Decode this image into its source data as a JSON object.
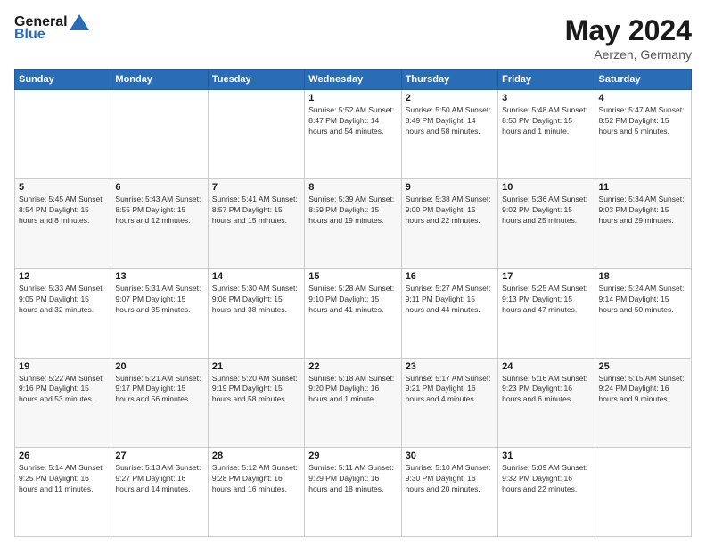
{
  "logo": {
    "text_general": "General",
    "text_blue": "Blue"
  },
  "title": {
    "month_year": "May 2024",
    "location": "Aerzen, Germany"
  },
  "weekdays": [
    "Sunday",
    "Monday",
    "Tuesday",
    "Wednesday",
    "Thursday",
    "Friday",
    "Saturday"
  ],
  "weeks": [
    [
      {
        "day": "",
        "info": ""
      },
      {
        "day": "",
        "info": ""
      },
      {
        "day": "",
        "info": ""
      },
      {
        "day": "1",
        "info": "Sunrise: 5:52 AM\nSunset: 8:47 PM\nDaylight: 14 hours\nand 54 minutes."
      },
      {
        "day": "2",
        "info": "Sunrise: 5:50 AM\nSunset: 8:49 PM\nDaylight: 14 hours\nand 58 minutes."
      },
      {
        "day": "3",
        "info": "Sunrise: 5:48 AM\nSunset: 8:50 PM\nDaylight: 15 hours\nand 1 minute."
      },
      {
        "day": "4",
        "info": "Sunrise: 5:47 AM\nSunset: 8:52 PM\nDaylight: 15 hours\nand 5 minutes."
      }
    ],
    [
      {
        "day": "5",
        "info": "Sunrise: 5:45 AM\nSunset: 8:54 PM\nDaylight: 15 hours\nand 8 minutes."
      },
      {
        "day": "6",
        "info": "Sunrise: 5:43 AM\nSunset: 8:55 PM\nDaylight: 15 hours\nand 12 minutes."
      },
      {
        "day": "7",
        "info": "Sunrise: 5:41 AM\nSunset: 8:57 PM\nDaylight: 15 hours\nand 15 minutes."
      },
      {
        "day": "8",
        "info": "Sunrise: 5:39 AM\nSunset: 8:59 PM\nDaylight: 15 hours\nand 19 minutes."
      },
      {
        "day": "9",
        "info": "Sunrise: 5:38 AM\nSunset: 9:00 PM\nDaylight: 15 hours\nand 22 minutes."
      },
      {
        "day": "10",
        "info": "Sunrise: 5:36 AM\nSunset: 9:02 PM\nDaylight: 15 hours\nand 25 minutes."
      },
      {
        "day": "11",
        "info": "Sunrise: 5:34 AM\nSunset: 9:03 PM\nDaylight: 15 hours\nand 29 minutes."
      }
    ],
    [
      {
        "day": "12",
        "info": "Sunrise: 5:33 AM\nSunset: 9:05 PM\nDaylight: 15 hours\nand 32 minutes."
      },
      {
        "day": "13",
        "info": "Sunrise: 5:31 AM\nSunset: 9:07 PM\nDaylight: 15 hours\nand 35 minutes."
      },
      {
        "day": "14",
        "info": "Sunrise: 5:30 AM\nSunset: 9:08 PM\nDaylight: 15 hours\nand 38 minutes."
      },
      {
        "day": "15",
        "info": "Sunrise: 5:28 AM\nSunset: 9:10 PM\nDaylight: 15 hours\nand 41 minutes."
      },
      {
        "day": "16",
        "info": "Sunrise: 5:27 AM\nSunset: 9:11 PM\nDaylight: 15 hours\nand 44 minutes."
      },
      {
        "day": "17",
        "info": "Sunrise: 5:25 AM\nSunset: 9:13 PM\nDaylight: 15 hours\nand 47 minutes."
      },
      {
        "day": "18",
        "info": "Sunrise: 5:24 AM\nSunset: 9:14 PM\nDaylight: 15 hours\nand 50 minutes."
      }
    ],
    [
      {
        "day": "19",
        "info": "Sunrise: 5:22 AM\nSunset: 9:16 PM\nDaylight: 15 hours\nand 53 minutes."
      },
      {
        "day": "20",
        "info": "Sunrise: 5:21 AM\nSunset: 9:17 PM\nDaylight: 15 hours\nand 56 minutes."
      },
      {
        "day": "21",
        "info": "Sunrise: 5:20 AM\nSunset: 9:19 PM\nDaylight: 15 hours\nand 58 minutes."
      },
      {
        "day": "22",
        "info": "Sunrise: 5:18 AM\nSunset: 9:20 PM\nDaylight: 16 hours\nand 1 minute."
      },
      {
        "day": "23",
        "info": "Sunrise: 5:17 AM\nSunset: 9:21 PM\nDaylight: 16 hours\nand 4 minutes."
      },
      {
        "day": "24",
        "info": "Sunrise: 5:16 AM\nSunset: 9:23 PM\nDaylight: 16 hours\nand 6 minutes."
      },
      {
        "day": "25",
        "info": "Sunrise: 5:15 AM\nSunset: 9:24 PM\nDaylight: 16 hours\nand 9 minutes."
      }
    ],
    [
      {
        "day": "26",
        "info": "Sunrise: 5:14 AM\nSunset: 9:25 PM\nDaylight: 16 hours\nand 11 minutes."
      },
      {
        "day": "27",
        "info": "Sunrise: 5:13 AM\nSunset: 9:27 PM\nDaylight: 16 hours\nand 14 minutes."
      },
      {
        "day": "28",
        "info": "Sunrise: 5:12 AM\nSunset: 9:28 PM\nDaylight: 16 hours\nand 16 minutes."
      },
      {
        "day": "29",
        "info": "Sunrise: 5:11 AM\nSunset: 9:29 PM\nDaylight: 16 hours\nand 18 minutes."
      },
      {
        "day": "30",
        "info": "Sunrise: 5:10 AM\nSunset: 9:30 PM\nDaylight: 16 hours\nand 20 minutes."
      },
      {
        "day": "31",
        "info": "Sunrise: 5:09 AM\nSunset: 9:32 PM\nDaylight: 16 hours\nand 22 minutes."
      },
      {
        "day": "",
        "info": ""
      }
    ]
  ]
}
